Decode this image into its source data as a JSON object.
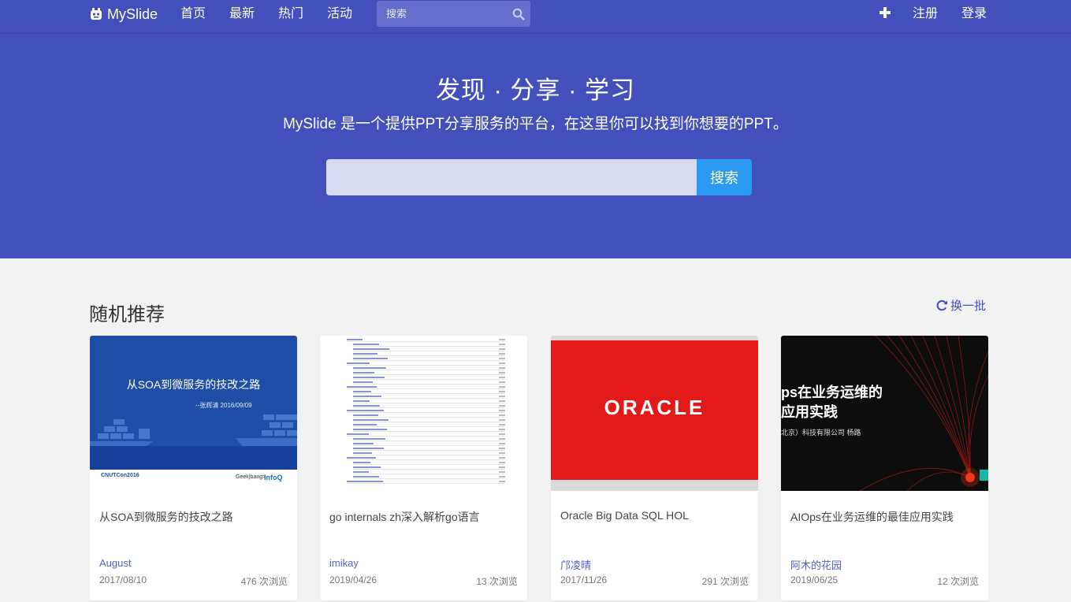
{
  "nav": {
    "brand": "MySlide",
    "links": [
      "首页",
      "最新",
      "热门",
      "活动"
    ],
    "search_placeholder": "搜索",
    "register": "注册",
    "login": "登录"
  },
  "hero": {
    "title": "发现 · 分享 · 学习",
    "subtitle": "MySlide 是一个提供PPT分享服务的平台，在这里你可以找到你想要的PPT。",
    "button": "搜索"
  },
  "section": {
    "title": "随机推荐",
    "refresh": "换一批"
  },
  "cards": [
    {
      "title": "从SOA到微服务的技改之路",
      "author": "August",
      "date": "2017/08/10",
      "views": "476 次浏览",
      "thumb": {
        "title": "从SOA到微服务的技改之路",
        "signature": "--张辉清 2016/09/09",
        "conference": "CNUTCon2016",
        "sponsor1": "Geek|bang>",
        "sponsor2": "InfoQ"
      }
    },
    {
      "title": "go internals zh深入解析go语言",
      "author": "imikay",
      "date": "2019/04/26",
      "views": "13 次浏览"
    },
    {
      "title": "Oracle Big Data SQL HOL",
      "author": "邝凌晴",
      "date": "2017/11/26",
      "views": "291 次浏览",
      "thumb": {
        "logo": "ORACLE"
      }
    },
    {
      "title": "AIOps在业务运维的最佳应用实践",
      "author": "阿木的花园",
      "date": "2019/06/25",
      "views": "12 次浏览",
      "thumb": {
        "line1": "ps在业务运维的",
        "line2": "应用实践",
        "line3": "北京）科技有限公司 杨路"
      }
    }
  ],
  "colors": {
    "primary": "#4350bc",
    "accent": "#2b9af3",
    "page_bg": "#f2f2f2"
  }
}
